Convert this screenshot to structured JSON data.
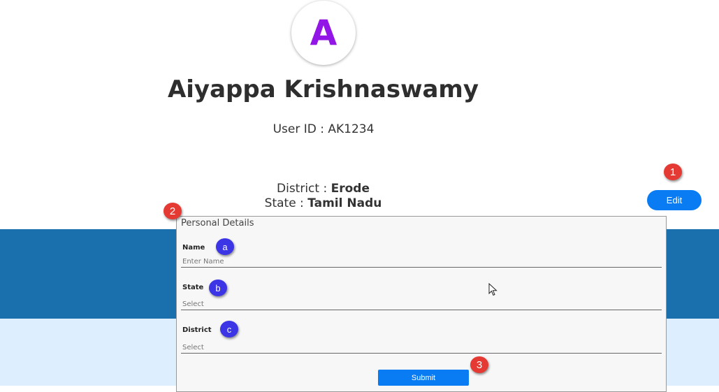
{
  "profile": {
    "avatar_letter": "A",
    "full_name": "Aiyappa Krishnaswamy",
    "user_id_label": "User ID : ",
    "user_id": "AK1234",
    "district_label": "District : ",
    "district": "Erode",
    "state_label": "State : ",
    "state": "Tamil Nadu"
  },
  "actions": {
    "edit_label": "Edit"
  },
  "form": {
    "title": "Personal Details",
    "fields": [
      {
        "label": "Name",
        "placeholder": "Enter Name"
      },
      {
        "label": "State",
        "placeholder": "Select"
      },
      {
        "label": "District",
        "placeholder": "Select"
      }
    ],
    "submit_label": "Submit"
  },
  "annotations": {
    "badge_1": "1",
    "badge_2": "2",
    "badge_3": "3",
    "badge_a": "a",
    "badge_b": "b",
    "badge_c": "c"
  },
  "colors": {
    "accent": "#0a7cf3",
    "avatar_letter": "#9216e6",
    "band_blue": "#1a6fad",
    "band_light": "#ddeeff",
    "badge_red": "#e53a34",
    "badge_purple": "#3b35e6"
  }
}
